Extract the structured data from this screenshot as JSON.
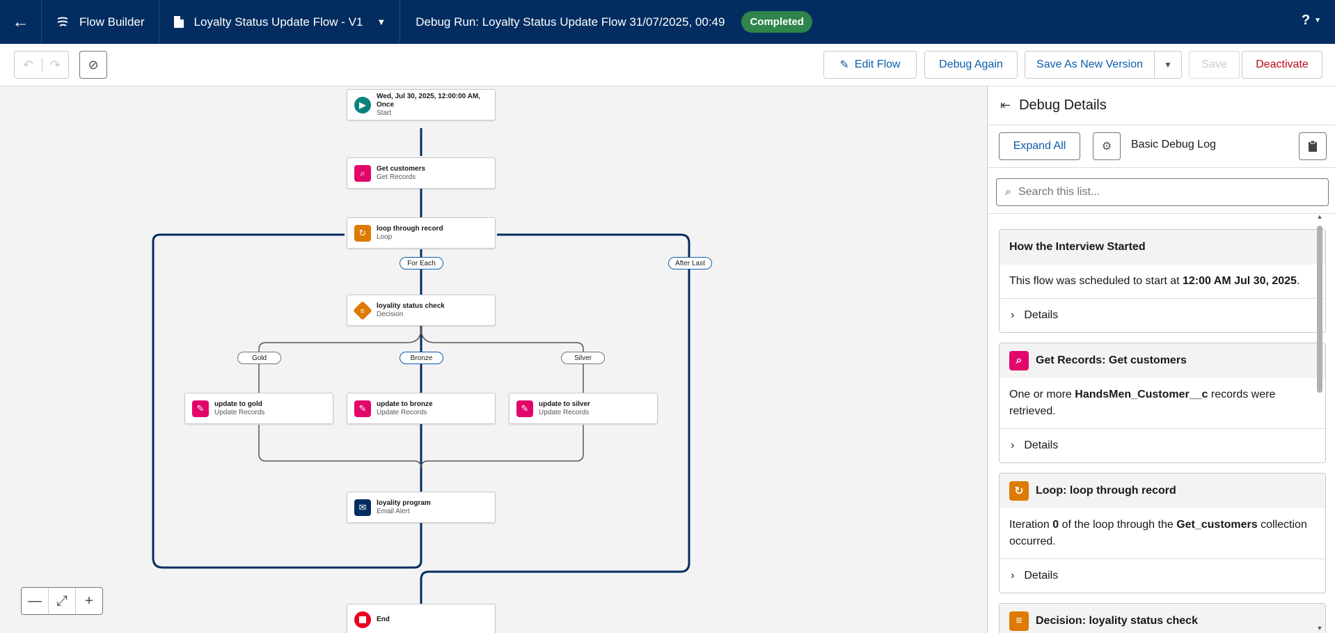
{
  "header": {
    "back_icon": "arrow-left-icon",
    "app_name": "Flow Builder",
    "flow_name": "Loyalty Status Update Flow - V1",
    "debug_title": "Debug Run: Loyalty Status Update Flow 31/07/2025, 00:49",
    "status_badge": "Completed",
    "help_label": "?",
    "colors": {
      "bar": "#032d60",
      "badge": "#2e844a"
    }
  },
  "toolbar": {
    "edit_flow": "Edit Flow",
    "debug_again": "Debug Again",
    "save_as_new_version": "Save As New Version",
    "save": "Save",
    "deactivate": "Deactivate"
  },
  "canvas": {
    "nodes": {
      "start": {
        "title": "Wed, Jul 30, 2025, 12:00:00 AM, Once",
        "title_line1": "Wed, Jul 30, 2025, 12:00:00 AM,",
        "title_line2": "Once",
        "type": "Start"
      },
      "get_customers": {
        "title": "Get customers",
        "type": "Get Records"
      },
      "loop": {
        "title": "loop through record",
        "type": "Loop"
      },
      "decision": {
        "title": "loyality status check",
        "type": "Decision"
      },
      "update_gold": {
        "title": "update to gold",
        "type": "Update Records"
      },
      "update_bronze": {
        "title": "update to bronze",
        "type": "Update Records"
      },
      "update_silver": {
        "title": "update to silver",
        "type": "Update Records"
      },
      "email": {
        "title": "loyality program",
        "type": "Email Alert"
      },
      "end": {
        "title": "End"
      }
    },
    "labels": {
      "for_each": "For Each",
      "after_last": "After Last",
      "gold": "Gold",
      "bronze": "Bronze",
      "silver": "Silver"
    },
    "zoom": {
      "out": "—",
      "fit": "⤢",
      "in": "+"
    }
  },
  "panel": {
    "title": "Debug Details",
    "expand_all": "Expand All",
    "log_level": "Basic Debug Log",
    "search_placeholder": "Search this list...",
    "cards": [
      {
        "title": "How the Interview Started",
        "body_pre": "This flow was scheduled to start at ",
        "body_bold": "12:00 AM Jul 30, 2025",
        "body_post": ".",
        "details": "Details"
      },
      {
        "title": "Get Records: Get customers",
        "body_pre": "One or more ",
        "body_bold": "HandsMen_Customer__c",
        "body_post": " records were retrieved.",
        "details": "Details"
      },
      {
        "title": "Loop: loop through record",
        "body_pre": "Iteration ",
        "body_bold": "0",
        "body_mid": " of the loop through the ",
        "body_bold2": "Get_customers",
        "body_post": " collection occurred.",
        "details": "Details"
      },
      {
        "title": "Decision: loyality status check"
      }
    ]
  }
}
